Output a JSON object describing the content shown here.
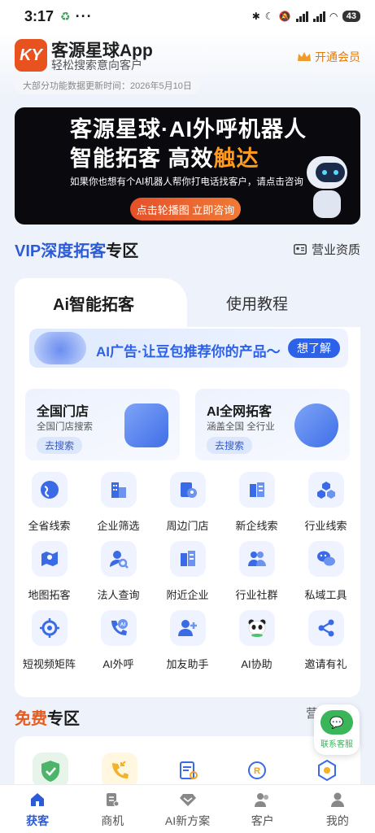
{
  "status_bar": {
    "time": "3:17",
    "more": "···",
    "battery": "43"
  },
  "header": {
    "logo_text": "KY",
    "app_name": "客源星球App",
    "app_subtitle": "轻松搜索意向客户",
    "vip_label": "开通会员",
    "update_notice": "大部分功能数据更新时间：2026年5月10日"
  },
  "banner": {
    "line1": "客源星球·AI外呼机器人",
    "line2_a": "智能拓客 高效",
    "line2_b": "触达",
    "line3": "如果你也想有个AI机器人帮你打电话找客户，请点击咨询",
    "button": "点击轮播图 立即咨询"
  },
  "vip_section": {
    "title_a": "VIP深度拓客",
    "title_b": "专区",
    "license": "营业资质"
  },
  "tabs": [
    {
      "label": "Ai智能拓客"
    },
    {
      "label": "使用教程"
    }
  ],
  "ai_strip": {
    "text": "AI广告·让豆包推荐你的产品～",
    "button": "想了解"
  },
  "features": [
    {
      "title": "全国门店",
      "subtitle": "全国门店搜索",
      "button": "去搜索"
    },
    {
      "title": "AI全网拓客",
      "subtitle": "涵盖全国 全行业",
      "button": "去搜索"
    }
  ],
  "grid": [
    {
      "label": "全省线索",
      "icon": "globe-icon"
    },
    {
      "label": "企业筛选",
      "icon": "building-icon"
    },
    {
      "label": "周边门店",
      "icon": "map-pin-icon"
    },
    {
      "label": "新企线索",
      "icon": "new-company-icon"
    },
    {
      "label": "行业线索",
      "icon": "industry-cubes-icon"
    },
    {
      "label": "地图拓客",
      "icon": "map-icon"
    },
    {
      "label": "法人查询",
      "icon": "person-search-icon"
    },
    {
      "label": "附近企业",
      "icon": "nearby-building-icon"
    },
    {
      "label": "行业社群",
      "icon": "group-icon"
    },
    {
      "label": "私域工具",
      "icon": "wechat-icon"
    },
    {
      "label": "短视频矩阵",
      "icon": "target-icon"
    },
    {
      "label": "AI外呼",
      "icon": "phone-ai-icon"
    },
    {
      "label": "加友助手",
      "icon": "add-friend-icon"
    },
    {
      "label": "AI协助",
      "icon": "panda-icon"
    },
    {
      "label": "邀请有礼",
      "icon": "share-icon"
    }
  ],
  "free_section": {
    "title_a": "免费",
    "title_b": "专区",
    "right_text": "营业资质"
  },
  "float_button": {
    "label": "联系客服"
  },
  "tabbar": [
    {
      "label": "获客",
      "icon": "home-icon",
      "active": true
    },
    {
      "label": "商机",
      "icon": "document-icon",
      "active": false
    },
    {
      "label": "AI新方案",
      "icon": "diamond-icon",
      "active": false
    },
    {
      "label": "客户",
      "icon": "customers-icon",
      "active": false
    },
    {
      "label": "我的",
      "icon": "profile-icon",
      "active": false
    }
  ],
  "colors": {
    "accent": "#2c5bd6",
    "orange": "#e85b1f",
    "vip": "#e07b10",
    "green": "#3ab559"
  }
}
